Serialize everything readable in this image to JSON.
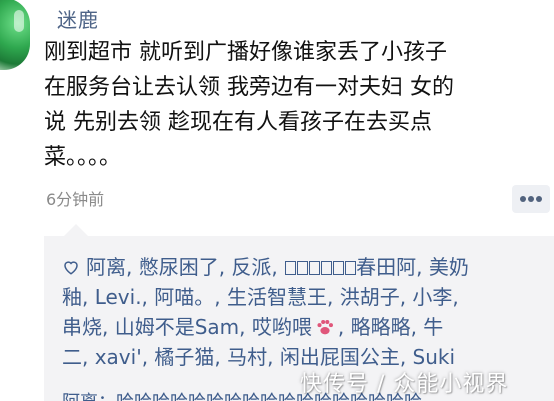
{
  "post": {
    "username": "迷鹿",
    "content_lines": [
      "刚到超市 就听到广播好像谁家丢了小孩子",
      "在服务台让去认领 我旁边有一对夫妇 女的",
      "说 先别去领 趁现在有人看孩子在去买点",
      "菜。。。。"
    ],
    "time": "6分钟前",
    "more_icon": "ellipsis-icon"
  },
  "likes": {
    "icon": "heart-icon",
    "line1_pre": "阿离, 憋尿困了, 反派, ",
    "line1_post": "春田阿, 美奶",
    "line2": "釉, Levi., 阿喵。, 生活智慧王, 洪胡子, 小李,",
    "line3_pre": "串烧, 山姆不是Sam, 哎哟喂",
    "line3_post": ", 略略略, 牛",
    "line4": "二, xavi', 橘子猫, 马村, 闲出屁国公主, Suki"
  },
  "comment_peek": "阿离：哈哈哈哈哈哈哈哈哈哈哈哈哈哈哈哈哈",
  "watermark": "快传号 / 众能小视界",
  "colors": {
    "name": "#4e6487",
    "link": "#3f5d8c",
    "panel": "#f3f3f5"
  }
}
